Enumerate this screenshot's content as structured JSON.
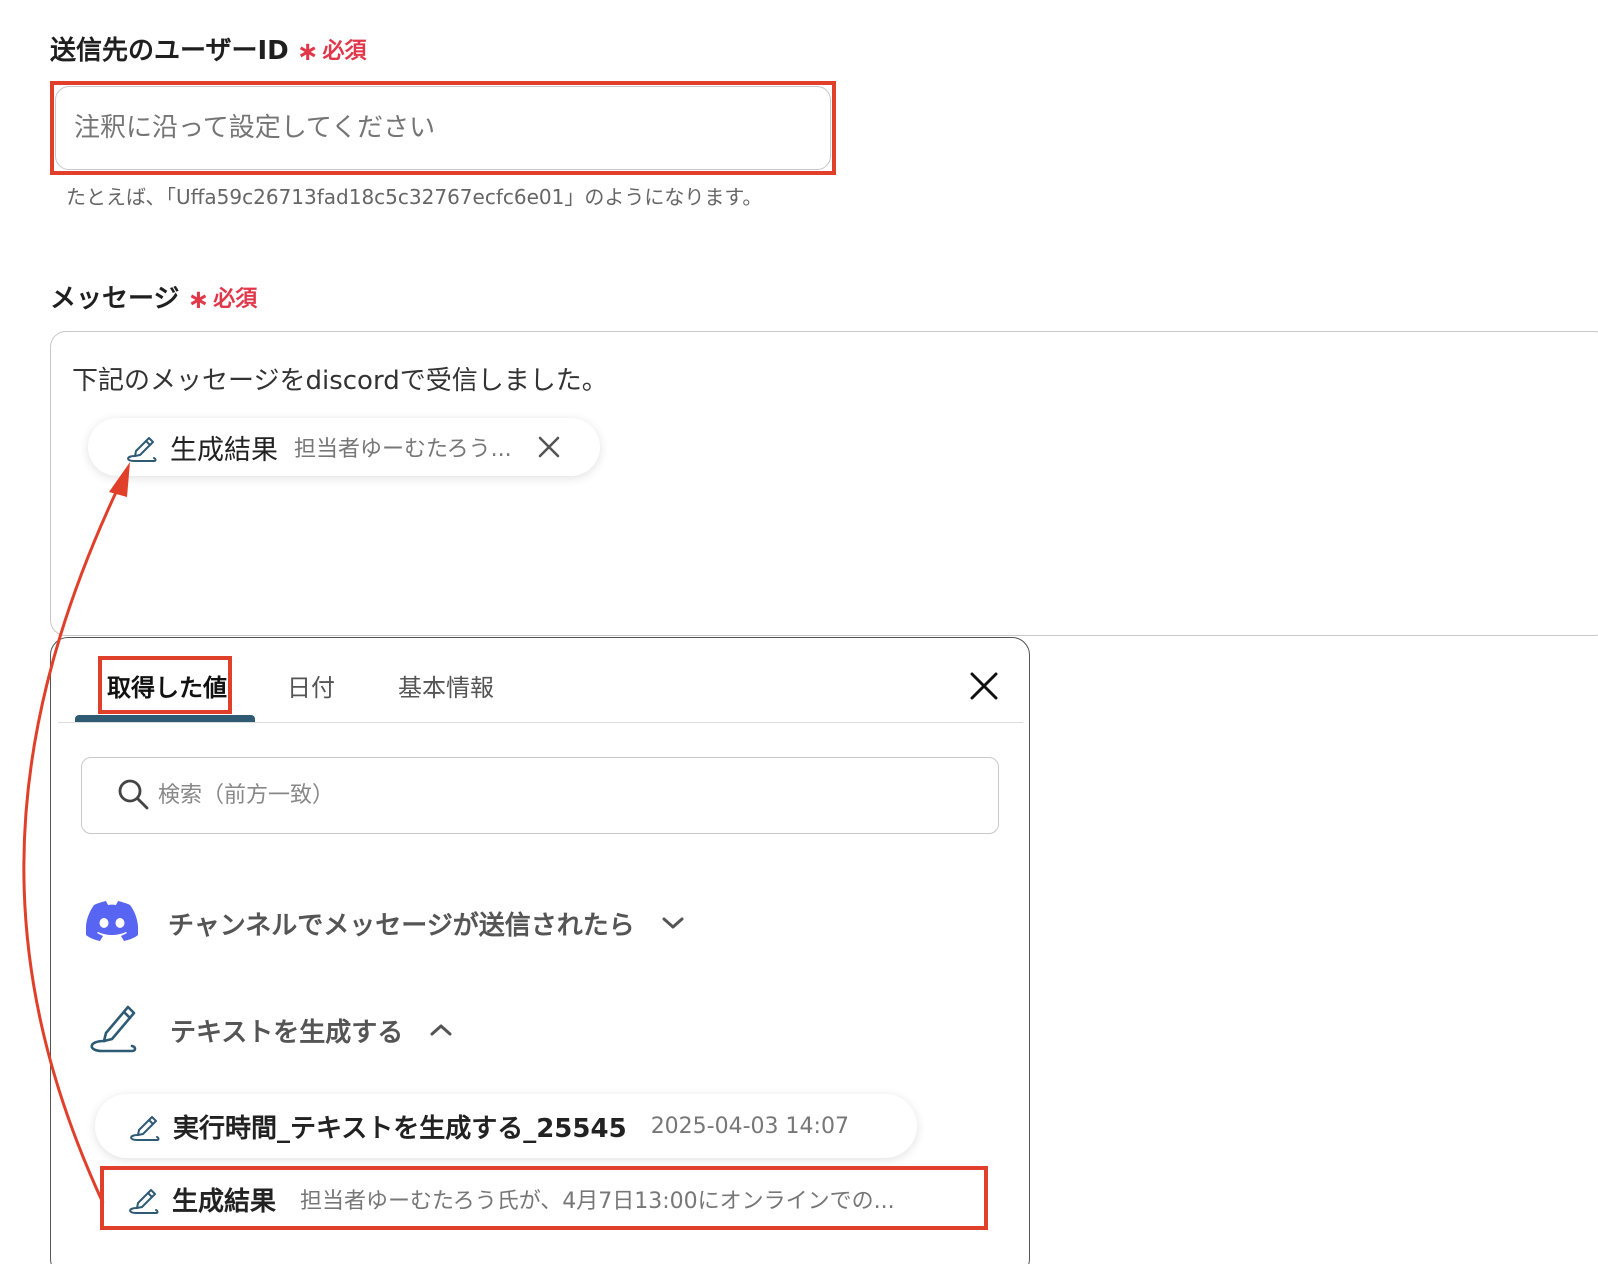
{
  "user_id_field": {
    "label": "送信先のユーザーID",
    "required": "必須",
    "placeholder": "注釈に沿って設定してください",
    "hint": "たとえば､「Uffa59c26713fad18c5c32767ecfc6e01」のようになります。"
  },
  "message_field": {
    "label": "メッセージ",
    "required": "必須",
    "text": "下記のメッセージをdiscordで受信しました。",
    "chip": {
      "title": "生成結果",
      "preview": "担当者ゆーむたろう..."
    }
  },
  "panel": {
    "tabs": [
      "取得した値",
      "日付",
      "基本情報"
    ],
    "search_placeholder": "検索（前方一致）",
    "groups": [
      {
        "label": "チャンネルでメッセージが送信されたら",
        "icon": "discord-icon",
        "expanded": false
      },
      {
        "label": "テキストを生成する",
        "icon": "ai-pen-icon",
        "expanded": true
      }
    ],
    "items": [
      {
        "title": "実行時間_テキストを生成する_25545",
        "value": "2025-04-03 14:07"
      },
      {
        "title": "生成結果",
        "value": "担当者ゆーむたろう氏が、4月7日13:00にオンラインでの..."
      }
    ]
  },
  "colors": {
    "accent": "#e0402a",
    "required": "#e0384a",
    "tab_underline": "#2f5a74",
    "discord": "#5865f2",
    "pen": "#2f5a74"
  }
}
